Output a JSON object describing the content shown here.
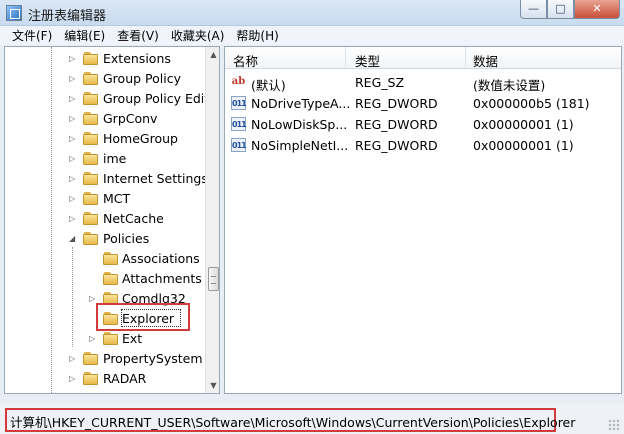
{
  "window": {
    "title": "注册表编辑器",
    "min": "—",
    "max": "□",
    "close": "✕"
  },
  "menu": [
    "文件(F)",
    "编辑(E)",
    "查看(V)",
    "收藏夹(A)",
    "帮助(H)"
  ],
  "tree": {
    "items": [
      {
        "label": "Extensions",
        "level": 1,
        "expander": "▷"
      },
      {
        "label": "Group Policy",
        "level": 1,
        "expander": "▷"
      },
      {
        "label": "Group Policy Edit",
        "level": 1,
        "expander": "▷"
      },
      {
        "label": "GrpConv",
        "level": 1,
        "expander": "▷"
      },
      {
        "label": "HomeGroup",
        "level": 1,
        "expander": "▷"
      },
      {
        "label": "ime",
        "level": 1,
        "expander": "▷"
      },
      {
        "label": "Internet Settings",
        "level": 1,
        "expander": "▷"
      },
      {
        "label": "MCT",
        "level": 1,
        "expander": "▷"
      },
      {
        "label": "NetCache",
        "level": 1,
        "expander": "▷"
      },
      {
        "label": "Policies",
        "level": 1,
        "expander": "◢"
      },
      {
        "label": "Associations",
        "level": 2,
        "expander": ""
      },
      {
        "label": "Attachments",
        "level": 2,
        "expander": ""
      },
      {
        "label": "Comdlg32",
        "level": 2,
        "expander": "▷"
      },
      {
        "label": "Explorer",
        "level": 2,
        "expander": ""
      },
      {
        "label": "Ext",
        "level": 2,
        "expander": "▷"
      },
      {
        "label": "PropertySystem",
        "level": 1,
        "expander": "▷"
      },
      {
        "label": "RADAR",
        "level": 1,
        "expander": "▷"
      }
    ],
    "selected": "Explorer"
  },
  "values": {
    "headers": {
      "name": "名称",
      "type": "类型",
      "data": "数据"
    },
    "rows": [
      {
        "icon": "ab",
        "kind": "string-value-icon",
        "name": "(默认)",
        "type": "REG_SZ",
        "data": "(数值未设置)"
      },
      {
        "icon": "011",
        "kind": "dword-value-icon",
        "name": "NoDriveTypeA...",
        "type": "REG_DWORD",
        "data": "0x000000b5 (181)"
      },
      {
        "icon": "011",
        "kind": "dword-value-icon",
        "name": "NoLowDiskSp...",
        "type": "REG_DWORD",
        "data": "0x00000001 (1)"
      },
      {
        "icon": "011",
        "kind": "dword-value-icon",
        "name": "NoSimpleNetI...",
        "type": "REG_DWORD",
        "data": "0x00000001 (1)"
      }
    ]
  },
  "status": {
    "path": "计算机\\HKEY_CURRENT_USER\\Software\\Microsoft\\Windows\\CurrentVersion\\Policies\\Explorer"
  }
}
